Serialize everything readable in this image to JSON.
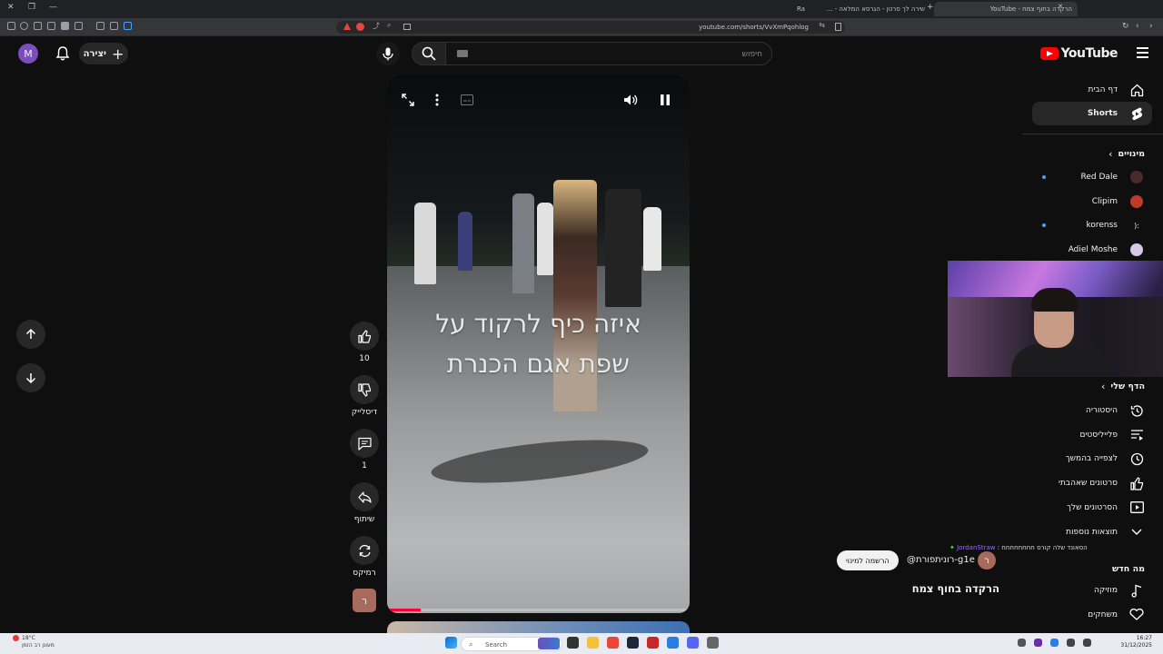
{
  "browser": {
    "tabs": [
      {
        "title": "הרקדה בחוף צמח - YouTube",
        "active": true
      },
      {
        "title": "שירה לך סרטן - הגרסא המלאה - ...",
        "active": false
      },
      {
        "title": "Ra",
        "active": false
      }
    ],
    "url": "youtube.com/shorts/VvXmPqohlog"
  },
  "header": {
    "logo_text": "YouTube",
    "search_placeholder": "חיפוש",
    "create_label": "יצירה",
    "avatar_letter": "M"
  },
  "sidebar": {
    "home_label": "דף הבית",
    "shorts_label": "Shorts",
    "subscriptions_heading": "מינויים",
    "subscriptions": [
      {
        "name": "Red Dale",
        "new": true,
        "avatar_color": "#4a2b2b"
      },
      {
        "name": "Clipim",
        "new": false,
        "avatar_color": "#c0392b"
      },
      {
        "name": "korenss",
        "new": true,
        "avatar_color": "#0f0f0f",
        "avatar_text": "):"
      },
      {
        "name": "Adiel Moshe",
        "new": false,
        "avatar_color": "#d8c8e8"
      }
    ],
    "you_heading": "הדף שלי",
    "you_items": [
      {
        "label": "היסטוריה",
        "icon": "history-icon"
      },
      {
        "label": "פלייליסטים",
        "icon": "playlist-icon"
      },
      {
        "label": "לצפייה בהמשך",
        "icon": "watch-later-icon"
      },
      {
        "label": "סרטונים שאהבתי",
        "icon": "thumbs-up-icon"
      },
      {
        "label": "הסרטונים שלך",
        "icon": "your-videos-icon"
      },
      {
        "label": "תוצאות נוספות",
        "icon": "chevron-down-icon"
      }
    ],
    "explore_heading": "מה חדש",
    "explore_items": [
      {
        "label": "מוזיקה",
        "icon": "music-icon"
      },
      {
        "label": "משחקים",
        "icon": "gaming-icon"
      }
    ]
  },
  "short": {
    "caption_line1": "איזה כיף לרקוד  על",
    "caption_line2": "שפת אגם הכנרת",
    "progress_fraction": 0.11,
    "likes": "10",
    "dislike_label": "דיסלייק",
    "comments": "1",
    "share_label": "שיתוף",
    "remix_label": "רמיקס",
    "channel_letter": "ר"
  },
  "overlay": {
    "chat_user": "JordanStraw",
    "chat_text": "הסאונד שלה קורס חחחחחחחח :",
    "subscribe_label": "הרשמה למינוי",
    "channel_handle": "@רונית‏פורת-g1e",
    "channel_letter": "ר",
    "video_title": "הרקדה בחוף צמח"
  },
  "taskbar": {
    "weather_temp": "18°C",
    "weather_desc": "מעונן רב הזמן",
    "search_label": "Search",
    "time": "16:27",
    "date": "31/12/2025"
  }
}
